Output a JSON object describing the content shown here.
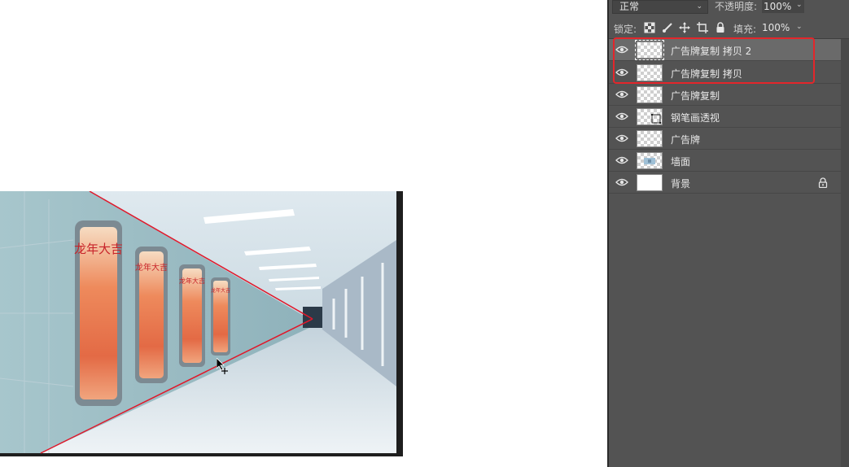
{
  "panel": {
    "blend_mode": "正常",
    "opacity_label": "不透明度:",
    "opacity_value": "100%",
    "lock_label": "锁定:",
    "fill_label": "填充:",
    "fill_value": "100%"
  },
  "layers": [
    {
      "name": "广告牌复制 拷贝 2",
      "visible": true,
      "selected": true,
      "thumb": "transparent",
      "locked": false
    },
    {
      "name": "广告牌复制 拷贝",
      "visible": true,
      "selected": false,
      "thumb": "transparent",
      "locked": false
    },
    {
      "name": "广告牌复制",
      "visible": true,
      "selected": false,
      "thumb": "transparent",
      "locked": false
    },
    {
      "name": "钢笔画透视",
      "visible": true,
      "selected": false,
      "thumb": "path",
      "locked": false
    },
    {
      "name": "广告牌",
      "visible": true,
      "selected": false,
      "thumb": "transparent",
      "locked": false
    },
    {
      "name": "墙面",
      "visible": true,
      "selected": false,
      "thumb": "image",
      "locked": false
    },
    {
      "name": "背景",
      "visible": true,
      "selected": false,
      "thumb": "white",
      "locked": true
    }
  ],
  "poster_text": "龙年大吉",
  "colors": {
    "highlight": "#e3262b",
    "panel_bg": "#535353",
    "selected_row": "#6a6a6a"
  }
}
